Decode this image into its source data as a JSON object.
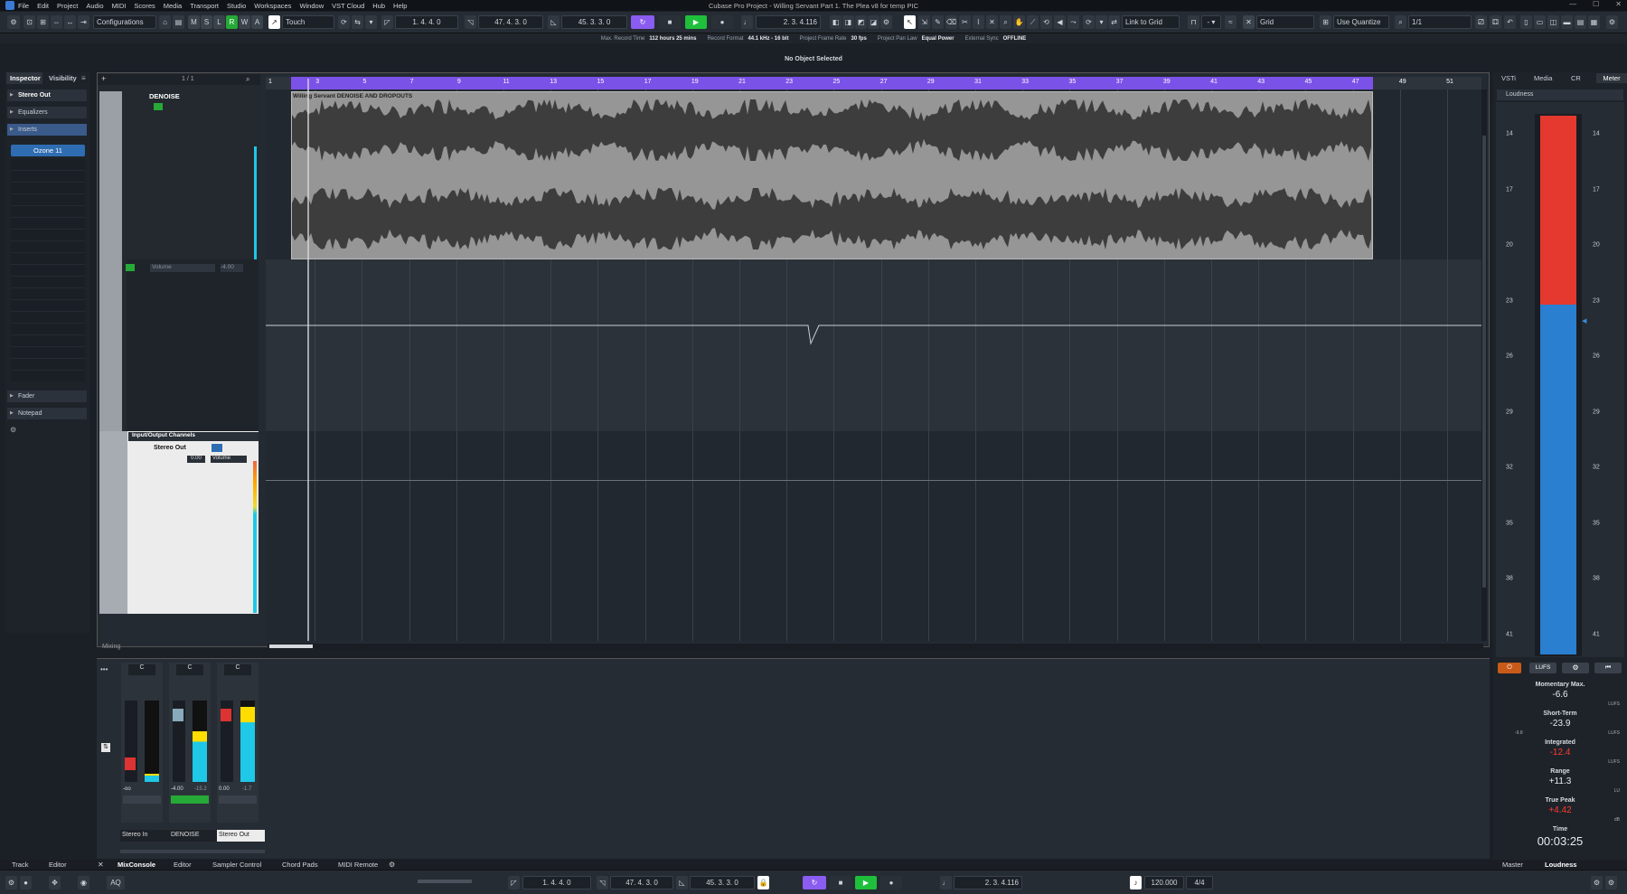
{
  "window": {
    "title": "Cubase Pro Project - Willing Servant Part 1. The Plea v8 for temp PIC"
  },
  "menu": [
    "File",
    "Edit",
    "Project",
    "Audio",
    "MIDI",
    "Scores",
    "Media",
    "Transport",
    "Studio",
    "Workspaces",
    "Window",
    "VST Cloud",
    "Hub",
    "Help"
  ],
  "toolbar": {
    "configurations": "Configurations",
    "mode_buttons": [
      "M",
      "S",
      "L",
      "R",
      "W",
      "A"
    ],
    "automation_mode": "Touch",
    "left_locator": "1. 4. 4.   0",
    "right_locator": "47. 4. 3.   0",
    "punch_position": "45. 3. 3.   0",
    "position": "2. 3. 4.116",
    "snap": "Link to Grid",
    "grid": "Grid",
    "quantize_mode": "Use Quantize",
    "quantize": "1/1"
  },
  "infobar": [
    {
      "k": "Max. Record Time",
      "v": "112 hours 25 mins"
    },
    {
      "k": "Record Format",
      "v": "44.1 kHz - 16 bit"
    },
    {
      "k": "Project Frame Rate",
      "v": "30 fps"
    },
    {
      "k": "Project Pan Law",
      "v": "Equal Power"
    },
    {
      "k": "External Sync",
      "v": "OFFLINE"
    }
  ],
  "status": "No Object Selected",
  "inspector": {
    "tabs": [
      "Inspector",
      "Visibility"
    ],
    "track_name": "Stereo Out",
    "sections": {
      "equalizers": "Equalizers",
      "inserts": "Inserts",
      "fader": "Fader",
      "notepad": "Notepad"
    },
    "insert_slot": "Ozone 11"
  },
  "tracks": {
    "counter": "1 / 1",
    "denoise_name": "DENOISE",
    "automation_param": "Volume",
    "automation_value": "-4.00",
    "folder": "Input/Output Channels",
    "stereo_out": "Stereo Out",
    "stereo_out_value": "0.00",
    "stereo_out_param": "Volume",
    "footer": "Mixing"
  },
  "ruler": {
    "bars": [
      "1",
      "3",
      "5",
      "7",
      "9",
      "11",
      "13",
      "15",
      "17",
      "19",
      "21",
      "23",
      "25",
      "27",
      "29",
      "31",
      "33",
      "35",
      "37",
      "39",
      "41",
      "43",
      "45",
      "47",
      "49",
      "51"
    ]
  },
  "clip": {
    "title": "Willing Servant DENOISE AND DROPOUTS"
  },
  "right_panel": {
    "tabs": [
      "VSTi",
      "Media",
      "CR",
      "Meter"
    ],
    "loudness_title": "Loudness",
    "scale": [
      "14",
      "17",
      "20",
      "23",
      "26",
      "29",
      "32",
      "35",
      "38",
      "41"
    ],
    "lufs_btn": "LUFS"
  },
  "loudness": {
    "momentary_label": "Momentary Max.",
    "momentary": "-6.6",
    "shortterm_label": "Short-Term",
    "shortterm": "-23.9",
    "shortterm_side": "-9.8",
    "integrated_label": "Integrated",
    "integrated": "-12.4",
    "range_label": "Range",
    "range": "+11.3",
    "truepeak_label": "True Peak",
    "truepeak": "+4.42",
    "time_label": "Time",
    "time": "00:03:25",
    "unit_lufs": "LUFS",
    "unit_lu": "LU",
    "unit_db": "dB",
    "red_color": "#e5392f",
    "blue_color": "#2a7fd0",
    "red_level": 0.35
  },
  "mixer": {
    "strips": [
      {
        "name": "Stereo In",
        "value": "-oo",
        "peak": ""
      },
      {
        "name": "DENOISE",
        "value": "-4.00",
        "peak": "-15.2"
      },
      {
        "name": "Stereo Out",
        "value": "0.00",
        "peak": "-1.7"
      }
    ],
    "pan": "C",
    "num1": "1",
    "num2": "1",
    "num3": "1"
  },
  "bottom_tabs": {
    "left": [
      "Track",
      "Editor"
    ],
    "center": [
      "MixConsole",
      "Editor",
      "Sampler Control",
      "Chord Pads",
      "MIDI Remote"
    ],
    "right": [
      "Master",
      "Loudness"
    ]
  },
  "transport": {
    "aq": "AQ",
    "left_locator": "1. 4. 4.   0",
    "right_locator": "47. 4. 3.   0",
    "punch": "45. 3. 3.   0",
    "position": "2. 3. 4.116",
    "tempo": "120.000",
    "signature": "4/4"
  }
}
